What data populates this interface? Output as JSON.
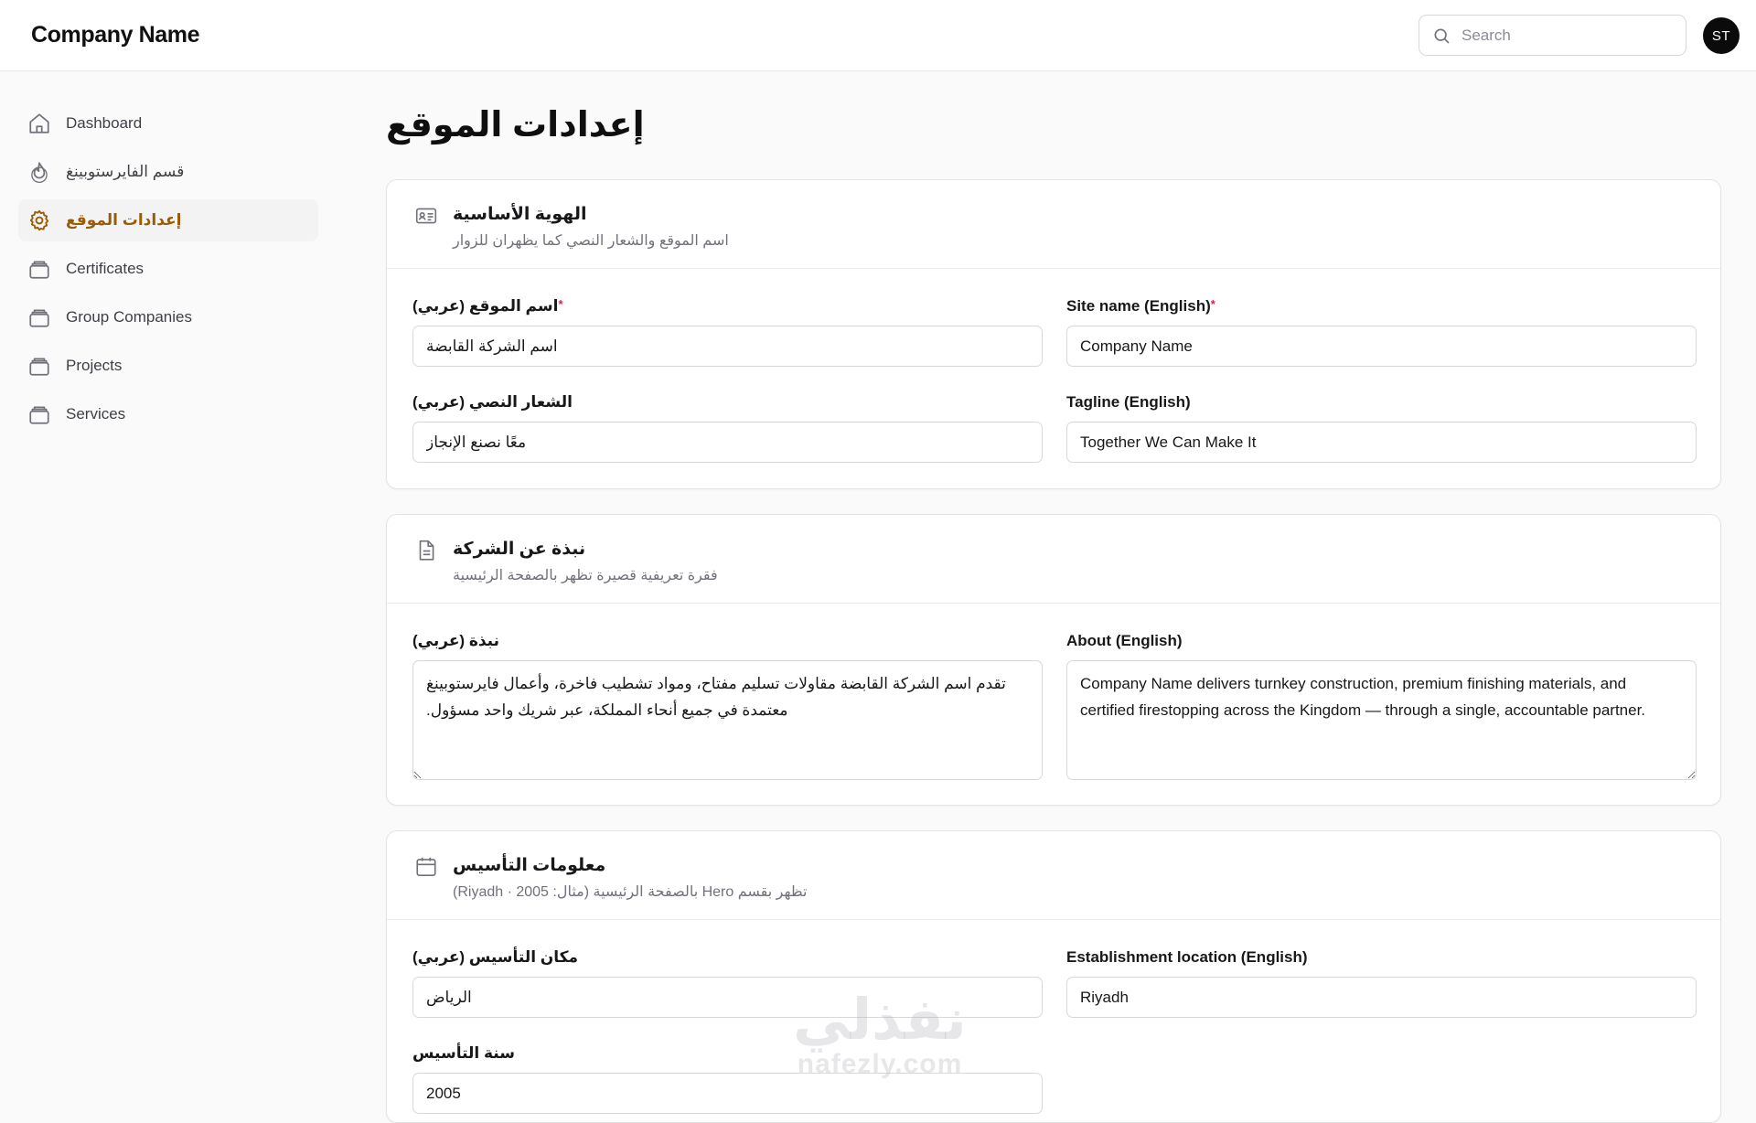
{
  "header": {
    "brand": "Company Name",
    "search_placeholder": "Search",
    "avatar_initials": "ST"
  },
  "sidebar": {
    "items": [
      {
        "label": "Dashboard",
        "icon": "home-icon",
        "active": false
      },
      {
        "label": "قسم الفايرستوبينغ",
        "icon": "flame-icon",
        "active": false
      },
      {
        "label": "إعدادات الموقع",
        "icon": "gear-icon",
        "active": true
      },
      {
        "label": "Certificates",
        "icon": "stack-icon",
        "active": false
      },
      {
        "label": "Group Companies",
        "icon": "stack-icon",
        "active": false
      },
      {
        "label": "Projects",
        "icon": "stack-icon",
        "active": false
      },
      {
        "label": "Services",
        "icon": "stack-icon",
        "active": false
      }
    ]
  },
  "main": {
    "title": "إعدادات الموقع",
    "identity": {
      "icon": "id-card-icon",
      "title": "الهوية الأساسية",
      "subtitle": "اسم الموقع والشعار النصي كما يظهران للزوار",
      "site_name_ar_label": "اسم الموقع (عربي)",
      "site_name_ar_value": "اسم الشركة القابضة",
      "site_name_en_label": "Site name (English)",
      "site_name_en_value": "Company Name",
      "tagline_ar_label": "الشعار النصي (عربي)",
      "tagline_ar_value": "معًا نصنع الإنجاز",
      "tagline_en_label": "Tagline (English)",
      "tagline_en_value": "Together We Can Make It",
      "required_mark": "*"
    },
    "about": {
      "icon": "document-icon",
      "title": "نبذة عن الشركة",
      "subtitle": "فقرة تعريفية قصيرة تظهر بالصفحة الرئيسية",
      "about_ar_label": "نبذة (عربي)",
      "about_ar_value": "تقدم اسم الشركة القابضة مقاولات تسليم مفتاح، ومواد تشطيب فاخرة، وأعمال فايرستوبينغ معتمدة في جميع أنحاء المملكة، عبر شريك واحد مسؤول.",
      "about_en_label": "About (English)",
      "about_en_value": "Company Name delivers turnkey construction, premium finishing materials, and certified firestopping across the Kingdom — through a single, accountable partner."
    },
    "establishment": {
      "icon": "calendar-icon",
      "title": "معلومات التأسيس",
      "subtitle": "تظهر بقسم Hero بالصفحة الرئيسية (مثال: Riyadh · 2005)",
      "location_ar_label": "مكان التأسيس (عربي)",
      "location_ar_value": "الرياض",
      "location_en_label": "Establishment location (English)",
      "location_en_value": "Riyadh",
      "year_label": "سنة التأسيس",
      "year_value": "2005"
    }
  },
  "watermark": {
    "ar": "نفذلي",
    "en": "nafezly.com"
  }
}
